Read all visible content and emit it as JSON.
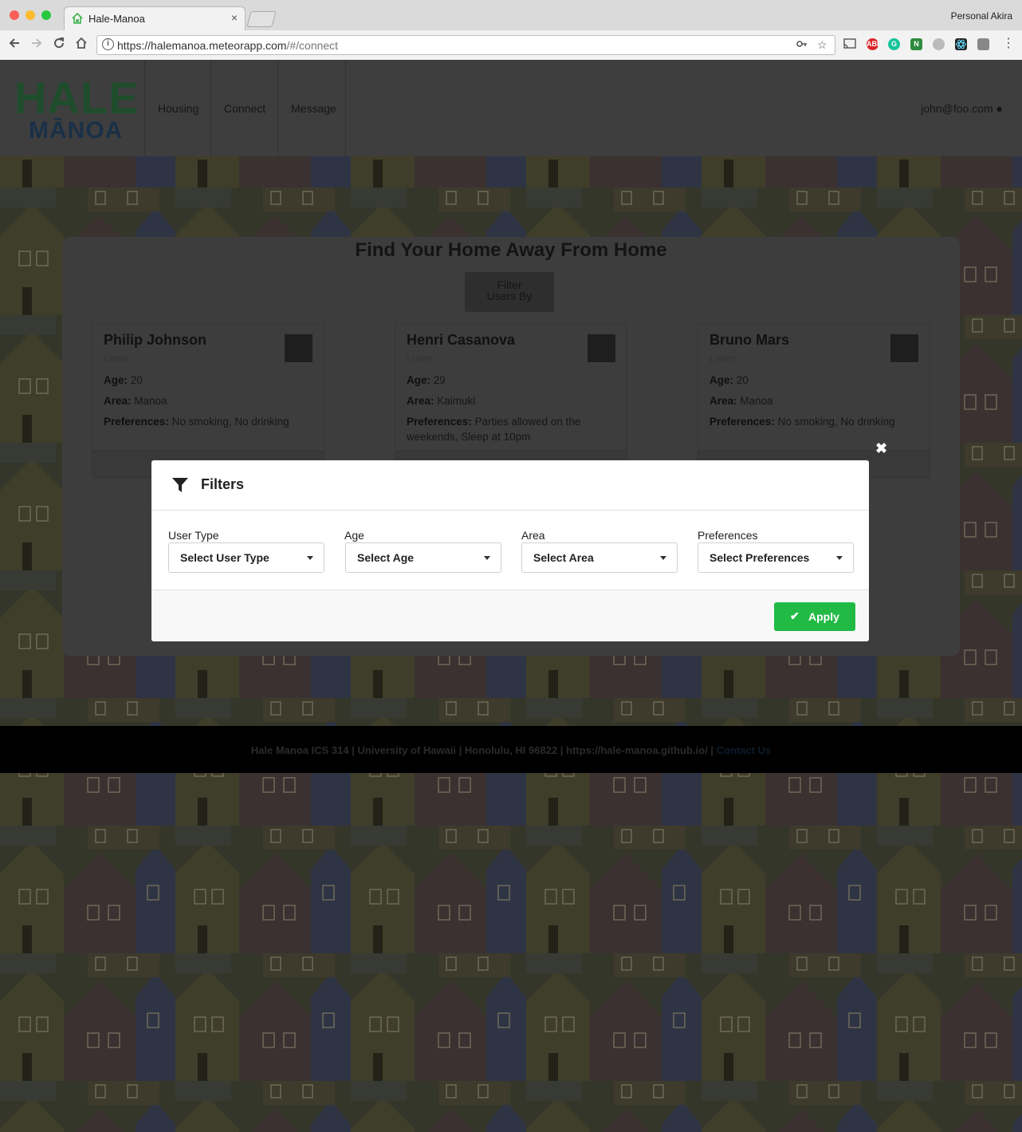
{
  "browser": {
    "tab_title": "Hale-Manoa",
    "tab_close": "×",
    "profile": "Personal Akira",
    "url_host": "https://halemanoa.meteorapp.com",
    "url_path": "/#/connect",
    "extensions": [
      "ABP",
      "G",
      "N"
    ]
  },
  "nav": {
    "logo_top": "HALE",
    "logo_bottom": "MĀNOA",
    "items": [
      {
        "label": "Housing"
      },
      {
        "label": "Connect"
      },
      {
        "label": "Message"
      }
    ],
    "user": "john@foo.com"
  },
  "main": {
    "heading": "Find Your Home Away From Home",
    "filter_button": [
      "Filter",
      "Users By"
    ],
    "cards": [
      {
        "name": "Philip Johnson",
        "role": "Lister",
        "age_label": "Age:",
        "age": "20",
        "area_label": "Area:",
        "area": "Manoa",
        "pref_label": "Preferences:",
        "prefs": "No smoking, No drinking"
      },
      {
        "name": "Henri Casanova",
        "role": "Lister",
        "age_label": "Age:",
        "age": "29",
        "area_label": "Area:",
        "area": "Kaimuki",
        "pref_label": "Preferences:",
        "prefs": "Parties allowed on the weekends, Sleep at 10pm"
      },
      {
        "name": "Bruno Mars",
        "role": "Lister",
        "age_label": "Age:",
        "age": "20",
        "area_label": "Area:",
        "area": "Manoa",
        "pref_label": "Preferences:",
        "prefs": "No smoking, No drinking"
      }
    ]
  },
  "footer": {
    "text": "Hale Manoa ICS 314  |  University of Hawaii  |  Honolulu, HI 96822  | https://hale-manoa.github.io/  |",
    "link": "Contact Us"
  },
  "modal": {
    "close": "✖",
    "title": "Filters",
    "fields": [
      {
        "label": "User Type",
        "value": "Select User Type"
      },
      {
        "label": "Age",
        "value": "Select Age"
      },
      {
        "label": "Area",
        "value": "Select Area"
      },
      {
        "label": "Preferences",
        "value": "Select Preferences"
      }
    ],
    "apply_label": "Apply",
    "apply_icon": "✔",
    "apply_color": "#21ba45"
  }
}
